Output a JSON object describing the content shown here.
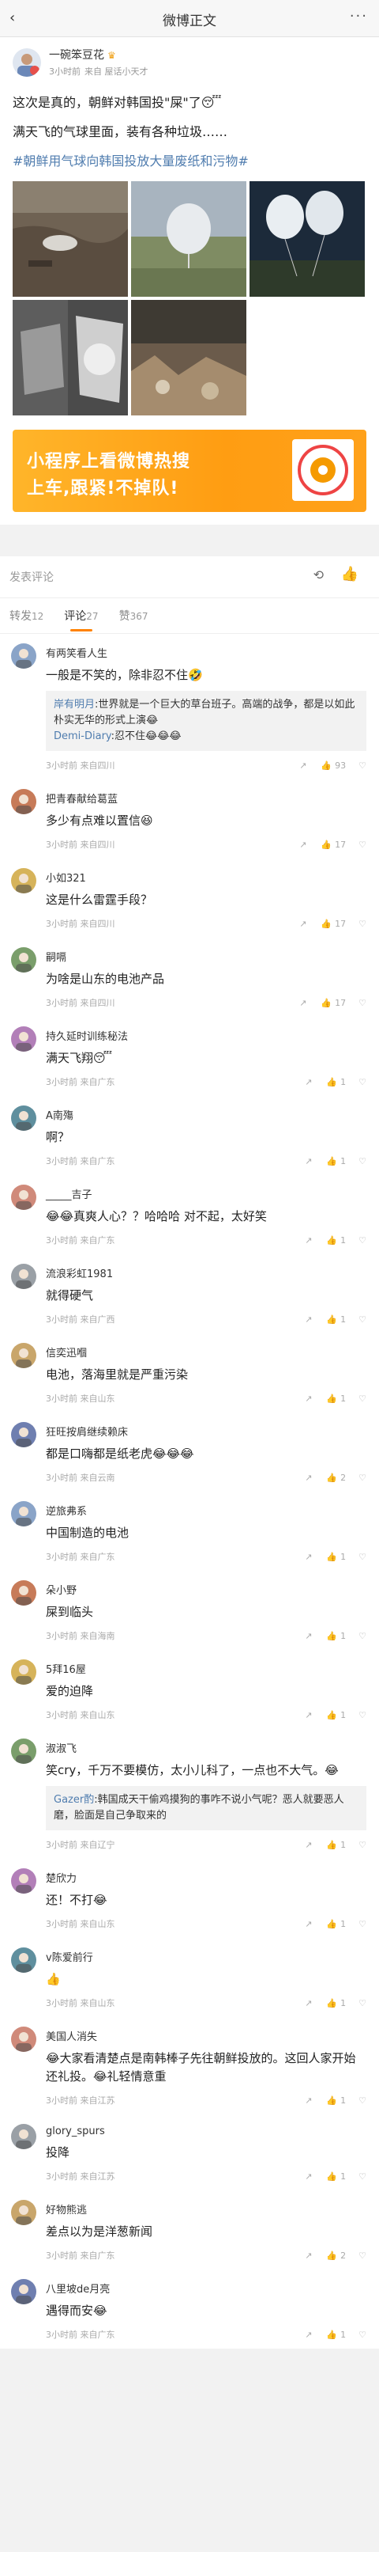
{
  "topbar": {
    "back_glyph": "‹",
    "title": "微博正文",
    "more_glyph": "···"
  },
  "author": {
    "name": "一碗笨豆花",
    "crown": "♛",
    "time": "3小时前",
    "source": "来自 屋话小天才"
  },
  "post": {
    "line1": "这次是真的，朝鲜对韩国投\"屎\"了😴",
    "line2": "满天飞的气球里面，装有各种垃圾……",
    "topic": "#朝鲜用气球向韩国投放大量废纸和污物#"
  },
  "banner": {
    "line1": "小程序上看微博热搜",
    "line2": "上车,跟紧!不掉队!"
  },
  "input": {
    "placeholder": "发表评论",
    "refresh_icon": "refresh-icon",
    "like_icon": "thumb-up-icon"
  },
  "tabs": [
    {
      "label": "转发",
      "count": "12"
    },
    {
      "label": "评论",
      "count": "27"
    },
    {
      "label": "赞",
      "count": "367"
    }
  ],
  "colors": {
    "accent": "#ff8200",
    "link": "#507daf",
    "banner": "#ffa11a"
  },
  "comments": [
    {
      "name": "有两笑看人生",
      "text": "一般是不笑的，除非忍不住🤣",
      "time": "3小时前 来自四川",
      "likes": "93",
      "replies": [
        {
          "user": "岸有明月",
          "text": ":世界就是一个巨大的草台班子。高端的战争，都是以如此朴实无华的形式上演😂"
        },
        {
          "user": "Demi-Diary",
          "text": ":忍不住😂😂😂"
        }
      ]
    },
    {
      "name": "把青春献给葛蓝",
      "text": "多少有点难以置信😆",
      "time": "3小时前 来自四川",
      "likes": "17"
    },
    {
      "name": "小如321",
      "text": "这是什么雷霆手段？",
      "time": "3小时前 来自四川",
      "likes": "17"
    },
    {
      "name": "嗣嗝",
      "text": "为啥是山东的电池产品",
      "time": "3小时前 来自四川",
      "likes": "17"
    },
    {
      "name": "持久延时训练秘法",
      "text": "满天飞翔😴",
      "time": "3小时前 来自广东",
      "likes": "1"
    },
    {
      "name": "A南殤",
      "text": "啊？",
      "time": "3小时前 来自广东",
      "likes": "1"
    },
    {
      "name": "_____吉子",
      "text": "😂😂真爽人心？？哈哈哈 对不起，太好笑",
      "time": "3小时前 来自广东",
      "likes": "1"
    },
    {
      "name": "流浪彩虹1981",
      "text": "就得硬气",
      "time": "3小时前 来自广西",
      "likes": "1"
    },
    {
      "name": "信奕迅嗰",
      "text": "电池，落海里就是严重污染",
      "time": "3小时前 来自山东",
      "likes": "1"
    },
    {
      "name": "狂旺按肩继续赖床",
      "text": "都是口嗨都是纸老虎😂😂😂",
      "time": "3小时前 来自云南",
      "likes": "2"
    },
    {
      "name": "逆旅弗系",
      "text": "中国制造的电池",
      "time": "3小时前 来自广东",
      "likes": "1"
    },
    {
      "name": "朵小野",
      "text": "屎到临头",
      "time": "3小时前 来自海南",
      "likes": "1"
    },
    {
      "name": "5拜16屋",
      "text": "爱的迫降",
      "time": "3小时前 来自山东",
      "likes": "1"
    },
    {
      "name": "淑淑飞",
      "text": "笑cry，千万不要模仿，太小儿科了，一点也不大气。😂",
      "time": "3小时前 来自辽宁",
      "likes": "1",
      "replies": [
        {
          "user": "Gazer酌",
          "text": ":韩国成天干偷鸡摸狗的事咋不说小气呢？恶人就要恶人磨，脸面是自己争取来的"
        }
      ]
    },
    {
      "name": "楚欣力",
      "text": "还！不打😂",
      "time": "3小时前 来自山东",
      "likes": "1"
    },
    {
      "name": "v陈爱前行",
      "text": "👍",
      "time": "3小时前 来自山东",
      "likes": "1"
    },
    {
      "name": "美国人消失",
      "text": "😂大家看清楚点是南韩棒子先往朝鲜投放的。这回人家开始还礼投。😂礼轻情意重",
      "time": "3小时前 来自江苏",
      "likes": "1"
    },
    {
      "name": "glory_spurs",
      "text": "投降",
      "time": "3小时前 来自江苏",
      "likes": "1"
    },
    {
      "name": "好物熊逃",
      "text": "差点以为是洋葱新闻",
      "time": "3小时前 来自广东",
      "likes": "2"
    },
    {
      "name": "八里坡de月亮",
      "text": "遇得而安😂",
      "time": "3小时前 来自广东",
      "likes": "1"
    }
  ]
}
